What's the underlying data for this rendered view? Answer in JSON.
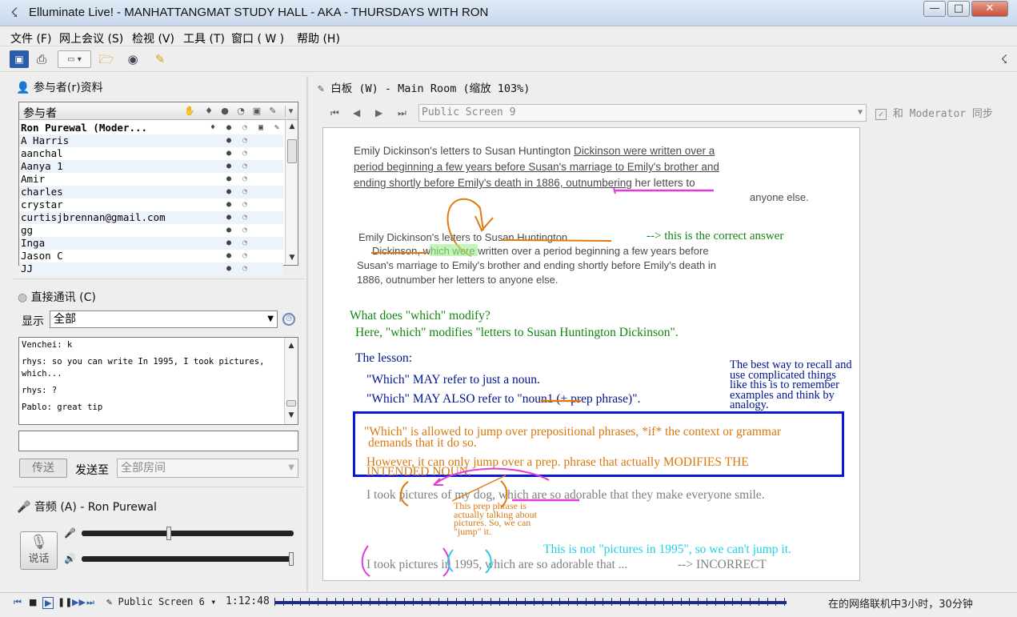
{
  "window": {
    "title": "Elluminate Live! - MANHATTANGMAT STUDY HALL - AKA - THURSDAYS WITH RON",
    "min": "—",
    "max": "□",
    "close": "✕"
  },
  "menu": [
    "文件 (F)",
    "网上会议 (S)",
    "检视 (V)",
    "工具 (T)",
    "窗口 ( W )",
    "帮助 (H)"
  ],
  "participants": {
    "title": "参与者(r)资料",
    "column_label": "参与者",
    "rows": [
      "Ron Purewal (Moder...",
      "A Harris",
      "aanchal",
      "Aanya 1",
      "Amir",
      "charles",
      "crystar",
      "curtisjbrennan@gmail.com",
      "gg",
      "Inga",
      "Jason C",
      "JJ"
    ]
  },
  "comm": {
    "title": "直接通讯 (C)",
    "show_label": "显示",
    "filter_value": "全部",
    "messages": [
      "Venchei: k",
      "rhys: so you can write In 1995, I took pictures, which...",
      "rhys: ?",
      "Pablo: great tip"
    ],
    "send_button": "传送",
    "sendto_label": "发送至",
    "sendto_value": "全部房间"
  },
  "audio": {
    "title": "音频 (A) - Ron Purewal",
    "talk_label": "说话",
    "mic_level": 0.41,
    "speaker_level": 1.0
  },
  "whiteboard": {
    "title": "白板 (W) - Main Room (缩放 103%)",
    "screen": "Public Screen 9",
    "sync_label": "和 Moderator 同步",
    "content": {
      "p1_a": "Emily Dickinson's letters to Susan Huntington ",
      "p1_b": "Dickinson were written over a",
      "p1_c": "period beginning a few years before Susan's marriage to Emily's brother and",
      "p1_d": "ending shortly before Emily's death in 1886, outnumbering",
      "p1_e": " her letters to",
      "p1_f": "anyone else.",
      "p2_a": "Emily Dickinson's letters to Susan Huntington",
      "p2_b": "Dickinson, which were written over a period beginning a few years before",
      "p2_c": "Susan's marriage to Emily's brother and ending shortly before Emily's death in",
      "p2_d": "1886, outnumber her letters to anyone else.",
      "correct": "--> this is the correct answer",
      "q1": "What does \"which\" modify?",
      "q2": "Here, \"which\" modifies \"letters to Susan Huntington Dickinson\".",
      "lesson": "The lesson:",
      "l1": "\"Which\" MAY refer to just a noun.",
      "l2": "\"Which\" MAY ALSO refer to \"noun1 (+ prep phrase)\".",
      "tip": "The best way to recall and use complicated things like this is to remember examples and think by analogy.",
      "box1": "\"Which\" is allowed to jump over prepositional phrases, *if* the context or grammar",
      "box2": "demands that it do so.",
      "box3": "However, it can only jump over a prep. phrase that actually MODIFIES THE",
      "box4": "INTENDED NOUN.",
      "ex1": "I took pictures of my dog, which are so adorable that they make everyone smile.",
      "note": "This prep phrase is actually talking about pictures. So, we can \"jump\" it.",
      "cyan_note": "This is not \"pictures in 1995\", so we can't jump it.",
      "ex2": "I took pictures in 1995, which are so adorable that ...",
      "incorrect": "--> INCORRECT"
    }
  },
  "bottom": {
    "screen": "Public Screen 6",
    "time": "1:12:48",
    "status": "在的网络联机中3小时，30分钟"
  }
}
